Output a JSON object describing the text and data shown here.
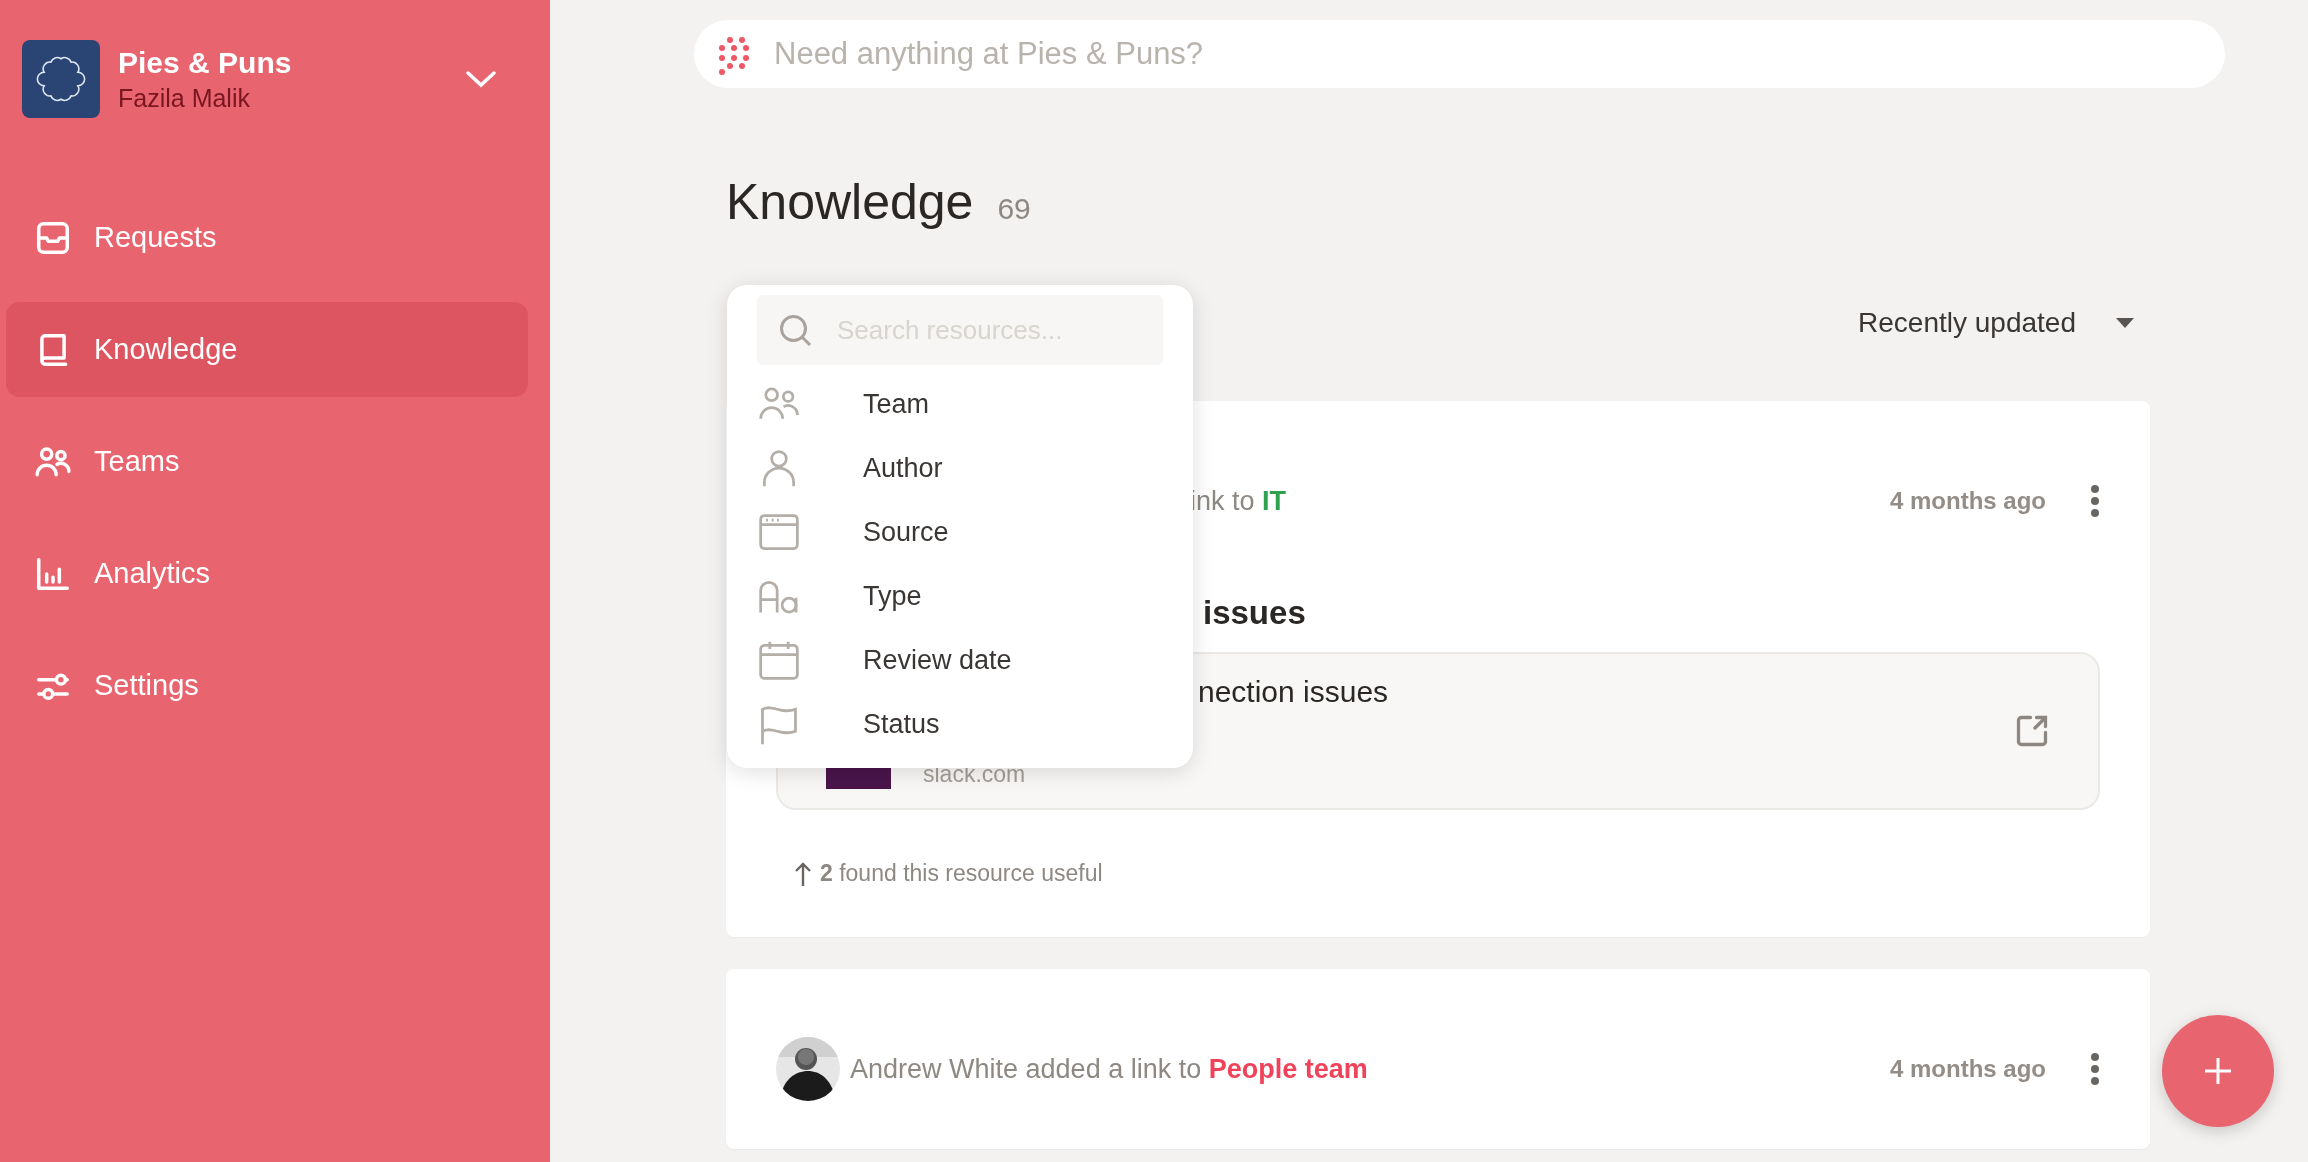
{
  "workspace": {
    "name": "Pies & Puns",
    "user": "Fazila Malik"
  },
  "nav": [
    {
      "label": "Requests",
      "selected": false
    },
    {
      "label": "Knowledge",
      "selected": true
    },
    {
      "label": "Teams",
      "selected": false
    },
    {
      "label": "Analytics",
      "selected": false
    },
    {
      "label": "Settings",
      "selected": false
    }
  ],
  "search": {
    "placeholder": "Need anything at Pies & Puns?"
  },
  "page": {
    "title": "Knowledge",
    "count": "69"
  },
  "sort": {
    "label": "Recently updated"
  },
  "filter_menu": {
    "search_placeholder": "Search resources...",
    "items": [
      {
        "label": "Team"
      },
      {
        "label": "Author"
      },
      {
        "label": "Source"
      },
      {
        "label": "Type"
      },
      {
        "label": "Review date"
      },
      {
        "label": "Status"
      }
    ]
  },
  "cards": [
    {
      "header_text": "ink to",
      "team": "IT",
      "color": "#2fa24f",
      "time": "4 months ago",
      "title": "issues",
      "link": {
        "title": "nection issues",
        "domain": "slack.com"
      },
      "useful": "**2** found this resource useful"
    },
    {
      "header_text": "Andrew White added a link to",
      "team": "People team",
      "color": "#f0435a",
      "time": "4 months ago"
    }
  ]
}
